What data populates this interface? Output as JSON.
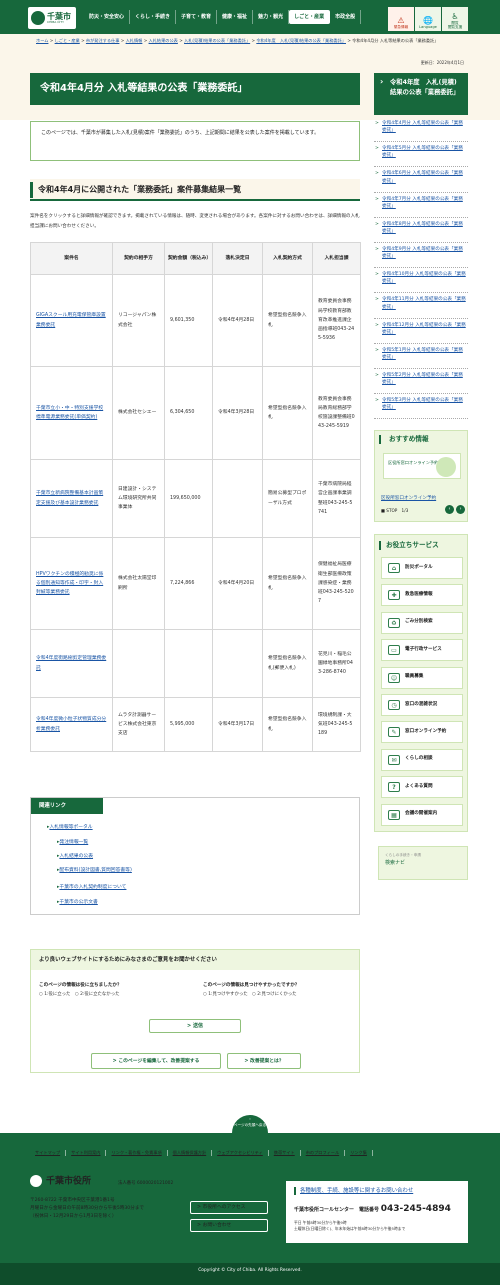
{
  "header": {
    "logo_name": "千葉市",
    "logo_sub": "CHIBA CITY",
    "nav": [
      "防災・安全安心",
      "くらし・手続き",
      "子育て・教育",
      "健康・福祉",
      "魅力・観光",
      "しごと・産業",
      "市政全般"
    ],
    "icons": [
      {
        "icon": "warning-icon",
        "glyph": "⚠",
        "label": "緊急情報"
      },
      {
        "icon": "language-icon",
        "glyph": "🌐",
        "label": "Language"
      },
      {
        "icon": "accessibility-icon",
        "glyph": "♿",
        "label": "閲覧\n閲覧支援"
      }
    ]
  },
  "breadcrumb": {
    "items": [
      "ホーム",
      "しごと・産業",
      "市が発注する仕事",
      "入札情報",
      "入札結果の公表",
      "入札(見積)結果の公表「業務委託」",
      "令和4年度　入札(見積)結果の公表「業務委託」"
    ],
    "current": "令和4年4月分 入札等結果の公表「業務委託」"
  },
  "updated": "更新日：2022年4月1日",
  "page_title": "令和4年4月分 入札等結果の公表「業務委託」",
  "intro": "このページでは、千葉市が募集した入札(見積)案件「業務委託」のうち、上記期間に結果を公表した案件を掲載しています。",
  "section_title": "令和4年4月に公開された「業務委託」案件募集結果一覧",
  "section_note": "案件名をクリックすると詳細情報が確認できます。掲載されている情報は、随時、変更される場合があります。各案件に対するお問い合わせは、詳細情報の入札担当課にお問い合わせください。",
  "table": {
    "headers": [
      "案件名",
      "契約の相手方",
      "契約金額（税込み）",
      "落札決定日",
      "入札契約方式",
      "入札担当課"
    ],
    "rows": [
      [
        "GIGAスクール用充電保管庫設置業務委託",
        "リコージャパン株式会社",
        "9,601,350",
        "令和4年4月28日",
        "希望型指名競争入札",
        "教育委員会事務局学校教育部教育改革推進課企画指導班043-245-5936"
      ],
      [
        "千葉市立小・中・特別支援学校標準電源業務委託(単価契約)",
        "株式会社セシエー",
        "6,304,650",
        "令和4年3月28日",
        "希望型指名競争入札",
        "教育委員会事務局教育総務部学校施設課整備班043-245-5919"
      ],
      [
        "千葉市立新病院整備基本計画策定支援及び基本設計業務委託",
        "日建設計・システム環境研究所共同事業体",
        "199,650,000",
        "",
        "簡易公募型プロポーザル方式",
        "千葉市病院局経営企画課事業調整班043-245-5741"
      ],
      [
        "HPVワクチンの積極的勧奨に係る個別通知等作成・印字・封入封緘等業務委託",
        "株式会社太陽堂印刷所",
        "7,224,866",
        "令和4年4月20日",
        "希望型指名競争入札",
        "保健福祉局医療衛生部医療政策課感染症・業務班043-245-5207"
      ],
      [
        "令和4年度街路樹剪定管理業務委託",
        "",
        "",
        "",
        "希望型指名競争入札(郵便入札)",
        "花見川・稲毛公園緑地事務所043-286-8740"
      ],
      [
        "令和4年度微小粒子状物質成分分析業務委託",
        "ムラタ計測器サービス株式会社東京支店",
        "5,995,000",
        "令和4年3月17日",
        "希望型指名競争入札",
        "環境規制課・大気班043-245-5189"
      ]
    ]
  },
  "sidebar": {
    "heading": "令和4年度　入札(見積)結果の公表「業務委託」",
    "items": [
      "令和4年4月分 入札等結果の公表「業務委託」",
      "令和4年5月分 入札等結果の公表「業務委託」",
      "令和4年6月分 入札等結果の公表「業務委託」",
      "令和4年7月分 入札等結果の公表「業務委託」",
      "令和4年8月分 入札等結果の公表「業務委託」",
      "令和4年9月分 入札等結果の公表「業務委託」",
      "令和4年10月分 入札等結果の公表「業務委託」",
      "令和4年11月分 入札等結果の公表「業務委託」",
      "令和4年12月分 入札等結果の公表「業務委託」",
      "令和5年1月分 入札等結果の公表「業務委託」",
      "令和5年2月分 入札等結果の公表「業務委託」",
      "令和5年3月分 入札等結果の公表「業務委託」"
    ]
  },
  "recommend": {
    "title": "おすすめ情報",
    "banner": "区役所窓口オンライン予約",
    "link": "区役所窓口オンライン予約",
    "stop": "STOP",
    "page": "1/3"
  },
  "useful": {
    "title": "お役立ちサービス",
    "items": [
      {
        "label": "防災ポータル",
        "icon": "disaster-icon",
        "glyph": "⌂"
      },
      {
        "label": "救急医療情報",
        "icon": "ambulance-icon",
        "glyph": "✚"
      },
      {
        "label": "ごみ分別検索",
        "icon": "trash-icon",
        "glyph": "♻"
      },
      {
        "label": "電子行政サービス",
        "icon": "computer-icon",
        "glyph": "▭"
      },
      {
        "label": "職員募集",
        "icon": "staff-icon",
        "glyph": "☺"
      },
      {
        "label": "窓口の混雑状況",
        "icon": "counter-icon",
        "glyph": "◷"
      },
      {
        "label": "窓口オンライン予約",
        "icon": "reservation-icon",
        "glyph": "✎"
      },
      {
        "label": "くらしの相談",
        "icon": "consult-icon",
        "glyph": "✉"
      },
      {
        "label": "よくある質問",
        "icon": "faq-icon",
        "glyph": "?"
      },
      {
        "label": "会議の開催案内",
        "icon": "meeting-icon",
        "glyph": "▦"
      }
    ]
  },
  "navi": {
    "small": "くらしの手続き・申請",
    "label": "検索ナビ"
  },
  "related": {
    "title": "関連リンク",
    "links": [
      "入札情報等ポータル",
      "発注情報一覧",
      "入札結果の公表",
      "配布資料(設計図書,質問回答書等)",
      "千葉市の入札契約制度について",
      "千葉市の公示文書"
    ]
  },
  "survey": {
    "title": "より良いウェブサイトにするためにみなさまのご意見をお聞かせください",
    "q1": "このページの情報は役に立ちましたか？",
    "q1_opts": "○ 1:役に立った　○ 2:役に立たなかった",
    "q2": "このページの情報は見つけやすかったですか？",
    "q2_opts": "○ 1:見つけやすかった　○ 2:見つけにくかった",
    "submit": "送信",
    "link1": "このページを編集して、改善提案する",
    "link2": "改善提案とは？"
  },
  "totop": "ページの先頭へ戻る",
  "footer": {
    "nav": [
      "サイトマップ",
      "サイト利用案内",
      "リンク・著作権・免責事項",
      "個人情報保護方針",
      "ウェブアクセシビリティ",
      "携帯サイト",
      "市のプロフィール",
      "リンク集"
    ],
    "name": "千葉市役所",
    "corp": "法人番号 6000020121002",
    "address": [
      "〒260-8722 千葉市中央区千葉港1番1号",
      "月曜日から金曜日の午前8時30分から午後5時30分まで",
      "（祝休日・12月29日から1月3日を除く）"
    ],
    "btn1": "市役所へのアクセス",
    "btn2": "お問い合わせ",
    "call_head": "各種制度、手続、施設等に関するお問い合わせ",
    "call_label": "千葉市役所コールセンター　電話番号",
    "call_number": "043-245-4894",
    "call_notes": [
      "平日 午前8時30分から午後9時",
      "土曜休日(日曜日除く)、年末年始は午前8時30分から午後5時まで"
    ],
    "copyright": "Copyright © City of Chiba. All Rights Reserved."
  }
}
